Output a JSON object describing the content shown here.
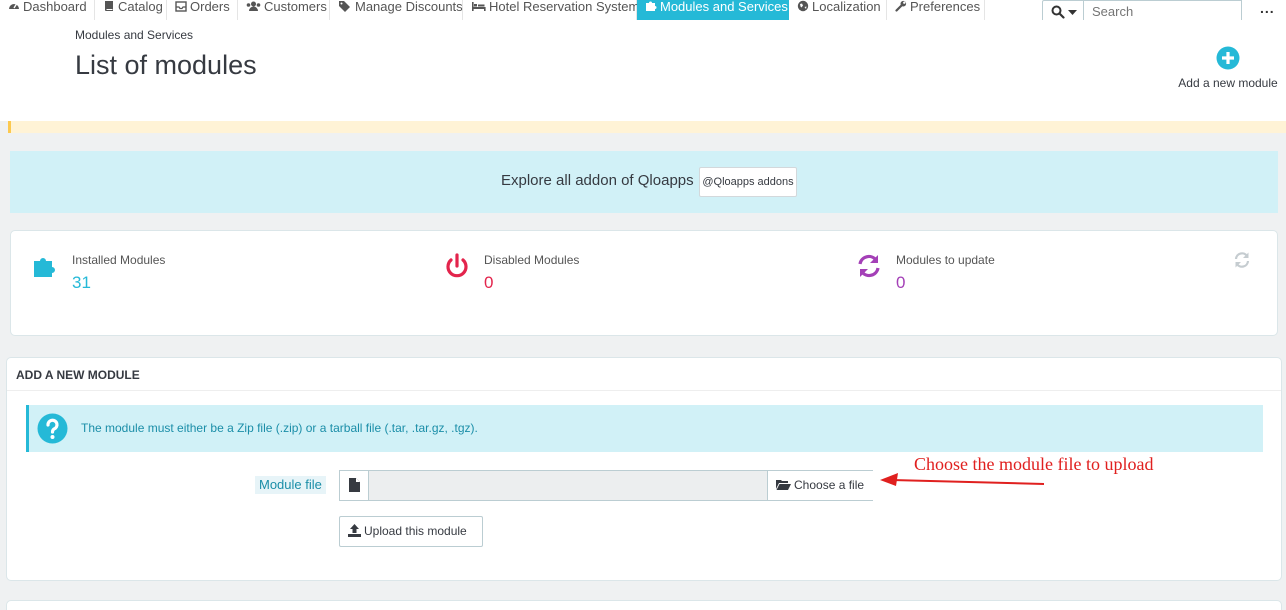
{
  "nav": {
    "items": [
      {
        "label": "Dashboard",
        "icon": "dashboard-icon"
      },
      {
        "label": "Catalog",
        "icon": "book-icon"
      },
      {
        "label": "Orders",
        "icon": "inbox-icon"
      },
      {
        "label": "Customers",
        "icon": "users-icon"
      },
      {
        "label": "Manage Discounts",
        "icon": "tag-icon"
      },
      {
        "label": "Hotel Reservation System",
        "icon": "bed-icon"
      },
      {
        "label": "Modules and Services",
        "icon": "puzzle-icon",
        "active": true
      },
      {
        "label": "Localization",
        "icon": "globe-icon"
      },
      {
        "label": "Preferences",
        "icon": "wrench-icon"
      }
    ],
    "search_placeholder": "Search",
    "more": "..."
  },
  "header": {
    "breadcrumb": "Modules and Services",
    "title": "List of modules",
    "add_module_label": "Add a new module"
  },
  "addons": {
    "text": "Explore all addon of Qloapps",
    "button": "@Qloapps addons"
  },
  "stats": {
    "installed": {
      "label": "Installed Modules",
      "value": "31",
      "color": "#25b9d7"
    },
    "disabled": {
      "label": "Disabled Modules",
      "value": "0",
      "color": "#e3244c"
    },
    "update": {
      "label": "Modules to update",
      "value": "0",
      "color": "#a440b7"
    }
  },
  "add_module": {
    "heading": "ADD A NEW MODULE",
    "info": "The module must either be a Zip file (.zip) or a tarball file (.tar, .tar.gz, .tgz).",
    "file_label": "Module file",
    "choose_label": "Choose a file",
    "upload_label": "Upload this module"
  },
  "annotation": {
    "text": "Choose the module file to upload",
    "color": "#e0201f"
  },
  "colors": {
    "accent": "#25b9d7",
    "danger": "#e3244c",
    "purple": "#a440b7"
  }
}
